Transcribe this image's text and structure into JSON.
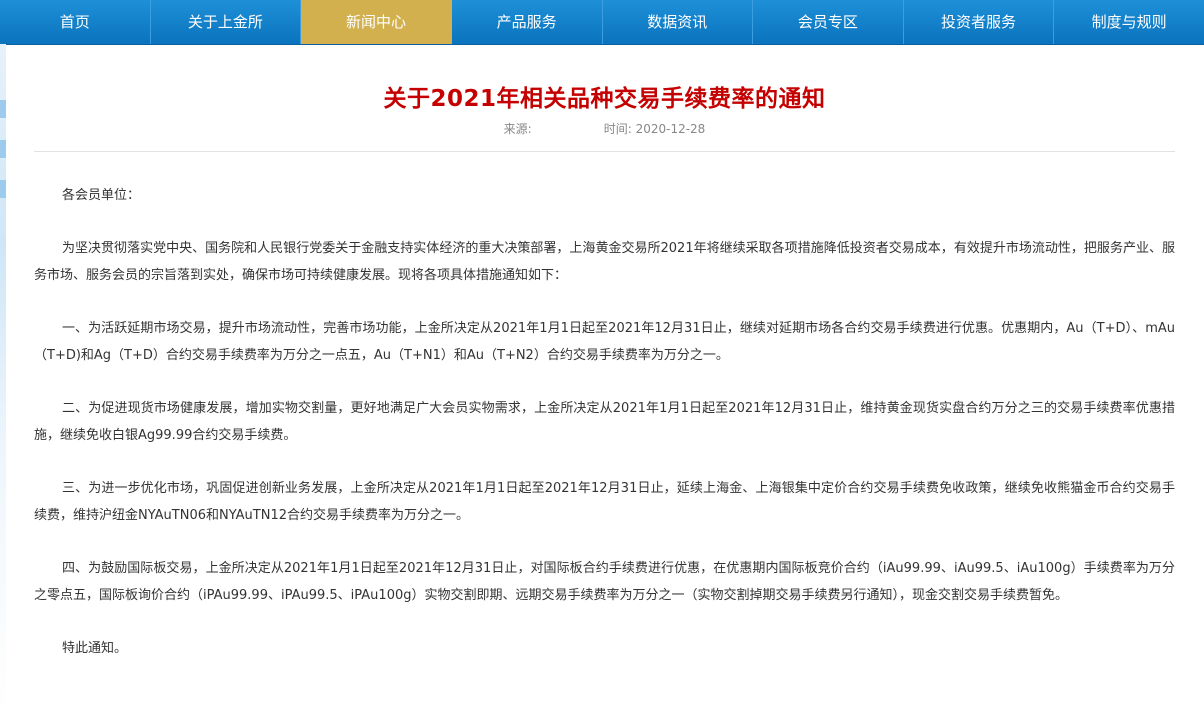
{
  "nav": {
    "items": [
      {
        "label": "首页",
        "active": false
      },
      {
        "label": "关于上金所",
        "active": false
      },
      {
        "label": "新闻中心",
        "active": true
      },
      {
        "label": "产品服务",
        "active": false
      },
      {
        "label": "数据资讯",
        "active": false
      },
      {
        "label": "会员专区",
        "active": false
      },
      {
        "label": "投资者服务",
        "active": false
      },
      {
        "label": "制度与规则",
        "active": false
      }
    ],
    "colors": {
      "bar": "#0a73bd",
      "active": "#d2b04d",
      "text": "#ffffff"
    }
  },
  "article": {
    "title": "关于2021年相关品种交易手续费率的通知",
    "title_color": "#c40000",
    "meta": {
      "source_label": "来源:",
      "source_value": "",
      "time_label": "时间:",
      "time_value": "2020-12-28"
    },
    "salutation": "各会员单位：",
    "paragraphs": [
      "为坚决贯彻落实党中央、国务院和人民银行党委关于金融支持实体经济的重大决策部署，上海黄金交易所2021年将继续采取各项措施降低投资者交易成本，有效提升市场流动性，把服务产业、服务市场、服务会员的宗旨落到实处，确保市场可持续健康发展。现将各项具体措施通知如下：",
      "一、为活跃延期市场交易，提升市场流动性，完善市场功能，上金所决定从2021年1月1日起至2021年12月31日止，继续对延期市场各合约交易手续费进行优惠。优惠期内，Au（T+D）、mAu（T+D)和Ag（T+D）合约交易手续费率为万分之一点五，Au（T+N1）和Au（T+N2）合约交易手续费率为万分之一。",
      "二、为促进现货市场健康发展，增加实物交割量，更好地满足广大会员实物需求，上金所决定从2021年1月1日起至2021年12月31日止，维持黄金现货实盘合约万分之三的交易手续费率优惠措施，继续免收白银Ag99.99合约交易手续费。",
      "三、为进一步优化市场，巩固促进创新业务发展，上金所决定从2021年1月1日起至2021年12月31日止，延续上海金、上海银集中定价合约交易手续费免收政策，继续免收熊猫金币合约交易手续费，维持沪纽金NYAuTN06和NYAuTN12合约交易手续费率为万分之一。",
      "四、为鼓励国际板交易，上金所决定从2021年1月1日起至2021年12月31日止，对国际板合约手续费进行优惠，在优惠期内国际板竞价合约（iAu99.99、iAu99.5、iAu100g）手续费率为万分之零点五，国际板询价合约（iPAu99.99、iPAu99.5、iPAu100g）实物交割即期、远期交易手续费率为万分之一（实物交割掉期交易手续费另行通知），现金交割交易手续费暂免。"
    ],
    "closing": "特此通知。"
  }
}
